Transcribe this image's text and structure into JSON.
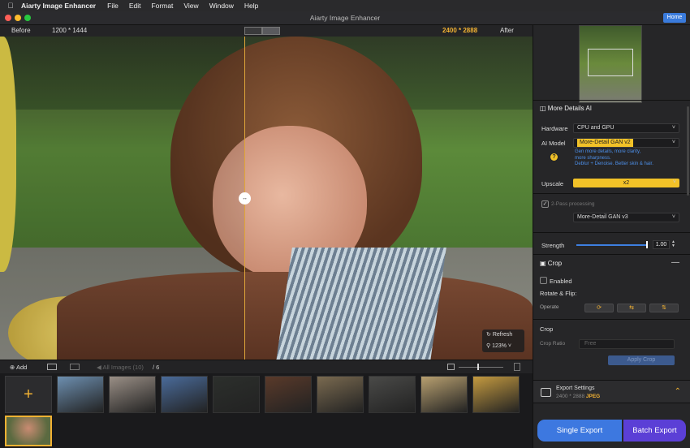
{
  "menubar": {
    "app_name": "Aiarty Image Enhancer",
    "items": [
      "File",
      "Edit",
      "Format",
      "View",
      "Window",
      "Help"
    ]
  },
  "window": {
    "title": "Aiarty Image Enhancer",
    "home_label": "Home"
  },
  "compare": {
    "before_label": "Before",
    "before_res": "1200 * 1444",
    "after_res": "2400 * 2888",
    "after_label": "After"
  },
  "preview": {
    "refresh_label": "Refresh",
    "zoom": "123%"
  },
  "filmstrip": {
    "add_label": "Add",
    "all_images_label": "All Images (10)",
    "count_label": "/ 6",
    "thumb_colors": [
      "#6d8fb0",
      "#9a8f86",
      "#4a6b9a",
      "#2c2f2c",
      "#5a3a2a",
      "#7a6a50",
      "#4a4a48",
      "#b8a070",
      "#c49a40"
    ]
  },
  "panel": {
    "section_title": "More Details AI",
    "hardware_label": "Hardware",
    "hardware_value": "CPU and GPU",
    "ai_model_label": "AI Model",
    "ai_model_value": "More-Detail GAN  v2",
    "model_desc_1": "Gen more details, more clarity,",
    "model_desc_2": "more sharpness.",
    "model_desc_3": "Deblur + Denoise. Better skin & hair.",
    "upscale_label": "Upscale",
    "upscale_value": "x2",
    "twopass_label": "2-Pass processing",
    "twopass_model": "More-Detail GAN  v3",
    "strength_label": "Strength",
    "strength_value": "1.00",
    "crop_title": "Crop",
    "enabled_label": "Enabled",
    "rotate_label": "Rotate & Flip:",
    "operate_label": "Operate",
    "crop_sub_label": "Crop",
    "crop_ratio_label": "Crop Ratio",
    "crop_ratio_value": "Free",
    "apply_crop_label": "Apply Crop",
    "export_settings_label": "Export Settings",
    "export_res": "2400 * 2888",
    "export_format": "JPEG",
    "single_export_label": "Single Export",
    "batch_export_label": "Batch Export"
  },
  "colors": {
    "accent_yellow": "#f2c228",
    "resolution_orange": "#f2b233",
    "single_export_blue": "#3d78e0",
    "batch_export_purple": "#5b3fd6"
  }
}
